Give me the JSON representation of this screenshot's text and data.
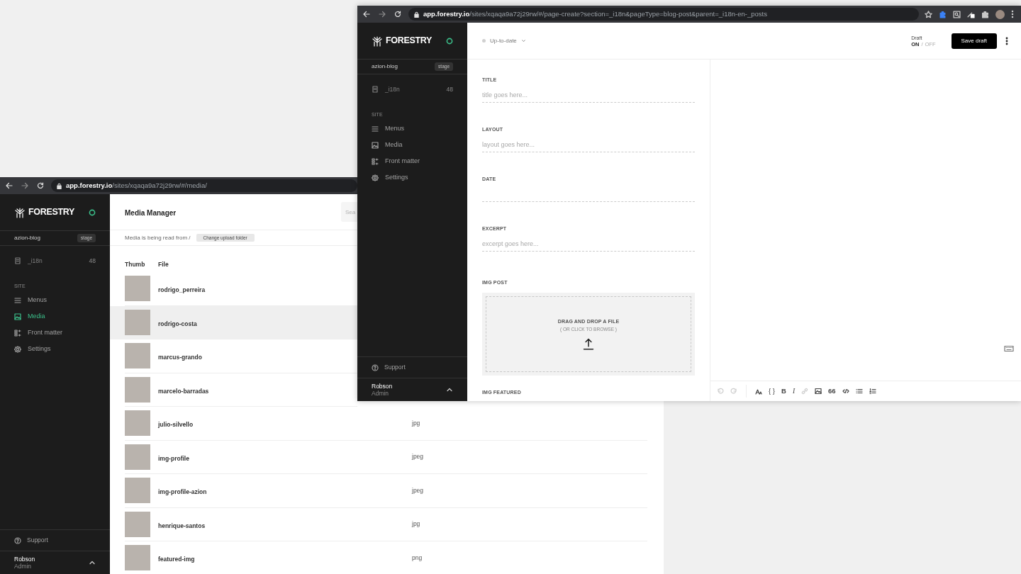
{
  "media_window": {
    "browser": {
      "url_domain": "app.forestry.io",
      "url_path": "/sites/xqaqa9a72j29rw/#/media/"
    },
    "sidebar": {
      "logo": "FORESTRY",
      "site": {
        "name": "azion-blog",
        "badge": "stage"
      },
      "section": {
        "label": "_i18n",
        "count": "48"
      },
      "group_label": "SITE",
      "nav": [
        {
          "kind": "menu",
          "label": "Menus",
          "selected": false
        },
        {
          "kind": "image",
          "label": "Media",
          "selected": true
        },
        {
          "kind": "frontmatter",
          "label": "Front matter",
          "selected": false
        },
        {
          "kind": "gear",
          "label": "Settings",
          "selected": false
        }
      ],
      "support": "Support",
      "user": {
        "name": "Robson",
        "role": "Admin"
      }
    },
    "header": {
      "title": "Media Manager",
      "search_placeholder": "Sea"
    },
    "upload_info": {
      "text": "Media is being read from /",
      "button": "Change upload folder"
    },
    "table": {
      "columns": [
        "Thumb",
        "File"
      ],
      "rows": [
        {
          "name": "rodrigo_perreira",
          "highlighted": false
        },
        {
          "name": "rodrigo-costa",
          "highlighted": true
        },
        {
          "name": "marcus-grando",
          "highlighted": false
        },
        {
          "name": "marcelo-barradas",
          "highlighted": false
        },
        {
          "name": "julio-silvello",
          "type": "jpg",
          "highlighted": false
        },
        {
          "name": "img-profile",
          "type": "jpeg",
          "highlighted": false
        },
        {
          "name": "img-profile-azion",
          "type": "jpeg",
          "highlighted": false
        },
        {
          "name": "henrique-santos",
          "type": "jpg",
          "highlighted": false
        },
        {
          "name": "featured-img",
          "type": "png",
          "highlighted": false
        }
      ]
    }
  },
  "editor_window": {
    "browser": {
      "url_domain": "app.forestry.io",
      "url_path": "/sites/xqaqa9a72j29rw/#/page-create?section=_i18n&pageType=blog-post&parent=_i18n-en-_posts"
    },
    "sidebar": {
      "logo": "FORESTRY",
      "site": {
        "name": "azion-blog",
        "badge": "stage"
      },
      "section": {
        "label": "_i18n",
        "count": "48"
      },
      "group_label": "SITE",
      "nav": [
        {
          "kind": "menu",
          "label": "Menus",
          "selected": false
        },
        {
          "kind": "image",
          "label": "Media",
          "selected": false
        },
        {
          "kind": "frontmatter",
          "label": "Front matter",
          "selected": false
        },
        {
          "kind": "gear",
          "label": "Settings",
          "selected": false
        }
      ],
      "support": "Support",
      "user": {
        "name": "Robson",
        "role": "Admin"
      }
    },
    "topbar": {
      "status": "Up-to-date",
      "draft": {
        "label": "Draft",
        "separator": "/",
        "options": [
          {
            "label": "ON",
            "selected": true
          },
          {
            "label": "OFF",
            "selected": false
          }
        ]
      },
      "save_button": "Save draft"
    },
    "fields": [
      {
        "kind": "text",
        "label": "TITLE",
        "placeholder": "title goes here..."
      },
      {
        "kind": "text",
        "label": "LAYOUT",
        "placeholder": "layout goes here..."
      },
      {
        "kind": "text",
        "label": "DATE"
      },
      {
        "kind": "text",
        "label": "EXCERPT",
        "placeholder": "excerpt goes here..."
      },
      {
        "kind": "dropzone",
        "label": "IMG POST",
        "title": "DRAG AND DROP A FILE",
        "hint": "( OR CLICK TO BROWSE )"
      },
      {
        "kind": "label",
        "label": "IMG FEATURED"
      }
    ],
    "editor": {
      "toolbar": [
        {
          "kind": "undo",
          "disabled": true
        },
        {
          "kind": "redo",
          "disabled": true
        },
        {
          "kind": "text-size",
          "disabled": false
        },
        {
          "kind": "braces",
          "label": "{ }",
          "disabled": false
        },
        {
          "kind": "bold",
          "label": "B",
          "disabled": false
        },
        {
          "kind": "italic",
          "label": "I",
          "disabled": false
        },
        {
          "kind": "link",
          "disabled": true
        },
        {
          "kind": "image",
          "disabled": false
        },
        {
          "kind": "quote",
          "label": "66",
          "disabled": false
        },
        {
          "kind": "code",
          "disabled": false
        },
        {
          "kind": "bullet-list",
          "disabled": false
        },
        {
          "kind": "numbered-list",
          "disabled": false
        }
      ]
    }
  }
}
